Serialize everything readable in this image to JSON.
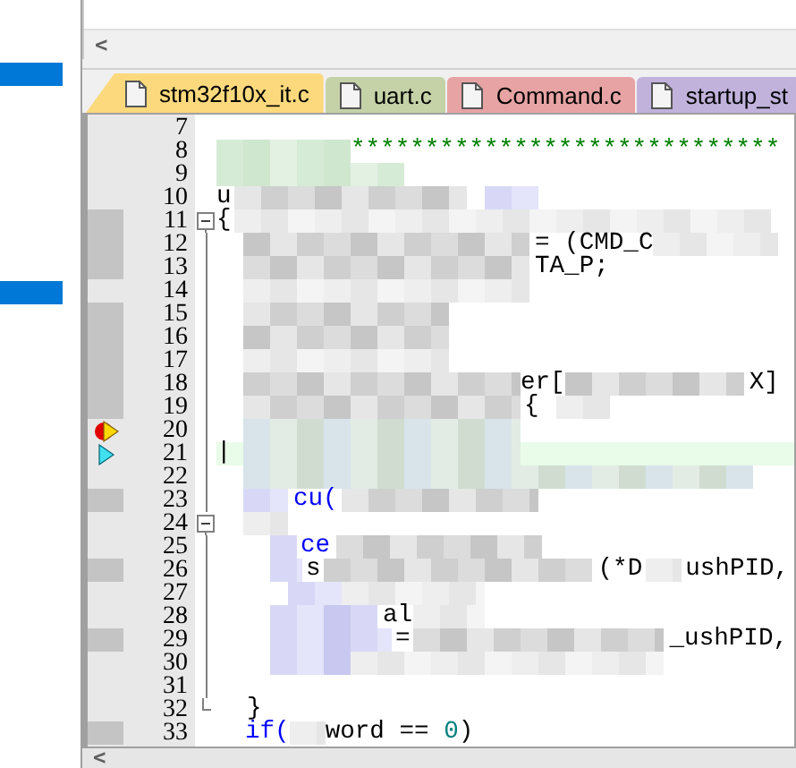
{
  "tabs": [
    {
      "label": "stm32f10x_it.c",
      "color": "#fcd97c",
      "selected": true
    },
    {
      "label": "uart.c",
      "color": "#c4d3a2",
      "selected": false
    },
    {
      "label": "Command.c",
      "color": "#f0a0a0",
      "selected": false
    },
    {
      "label": "startup_st",
      "color": "#c2b1e2",
      "selected": false
    }
  ],
  "scroll_left": "<",
  "lines": [
    {
      "number": "7",
      "current": false
    },
    {
      "number": "8",
      "current": false,
      "segments": [
        {
          "kind": "comment",
          "text": "*****************************"
        }
      ]
    },
    {
      "number": "9",
      "current": false
    },
    {
      "number": "10",
      "current": false,
      "segments": [
        {
          "kind": "plain",
          "text": "u"
        }
      ]
    },
    {
      "number": "11",
      "current": false,
      "collapsed": false,
      "segments": [
        {
          "kind": "plain",
          "text": "{"
        }
      ]
    },
    {
      "number": "12",
      "current": false,
      "segments": [
        {
          "kind": "plain",
          "text": "= (CMD_C"
        }
      ]
    },
    {
      "number": "13",
      "current": false,
      "segments": [
        {
          "kind": "plain",
          "text": "TA_P;"
        }
      ]
    },
    {
      "number": "14",
      "current": false
    },
    {
      "number": "15",
      "current": false
    },
    {
      "number": "16",
      "current": false
    },
    {
      "number": "17",
      "current": false
    },
    {
      "number": "18",
      "current": false,
      "segments": [
        {
          "kind": "plain",
          "text": "er["
        },
        {
          "kind": "plain",
          "text": "X]"
        }
      ]
    },
    {
      "number": "19",
      "current": false,
      "segments": [
        {
          "kind": "plain",
          "text": "{"
        }
      ]
    },
    {
      "number": "20",
      "current": false,
      "breakpoint": true
    },
    {
      "number": "21",
      "current": true,
      "segments": [
        {
          "kind": "plain",
          "text": "|"
        }
      ]
    },
    {
      "number": "22",
      "current": false
    },
    {
      "number": "23",
      "current": false,
      "segments": [
        {
          "kind": "keyword",
          "text": "cu("
        }
      ]
    },
    {
      "number": "24",
      "current": false,
      "collapsed": false
    },
    {
      "number": "25",
      "current": false,
      "segments": [
        {
          "kind": "keyword",
          "text": "ce"
        }
      ]
    },
    {
      "number": "26",
      "current": false,
      "segments": [
        {
          "kind": "plain",
          "text": "s"
        },
        {
          "kind": "plain",
          "text": "(*D"
        },
        {
          "kind": "plain",
          "text": "ushPID,"
        }
      ]
    },
    {
      "number": "27",
      "current": false
    },
    {
      "number": "28",
      "current": false,
      "segments": [
        {
          "kind": "plain",
          "text": "al"
        }
      ]
    },
    {
      "number": "29",
      "current": false,
      "segments": [
        {
          "kind": "plain",
          "text": "="
        },
        {
          "kind": "plain",
          "text": "_ushPID,"
        }
      ]
    },
    {
      "number": "30",
      "current": false
    },
    {
      "number": "31",
      "current": false
    },
    {
      "number": "32",
      "current": false,
      "fold_end": true,
      "segments": [
        {
          "kind": "plain",
          "text": "}"
        }
      ]
    },
    {
      "number": "33",
      "current": false,
      "segments": [
        {
          "kind": "keyword",
          "text": "if("
        },
        {
          "kind": "plain",
          "text": "word == "
        },
        {
          "kind": "number",
          "text": "0"
        },
        {
          "kind": "plain",
          "text": ")"
        }
      ]
    }
  ]
}
